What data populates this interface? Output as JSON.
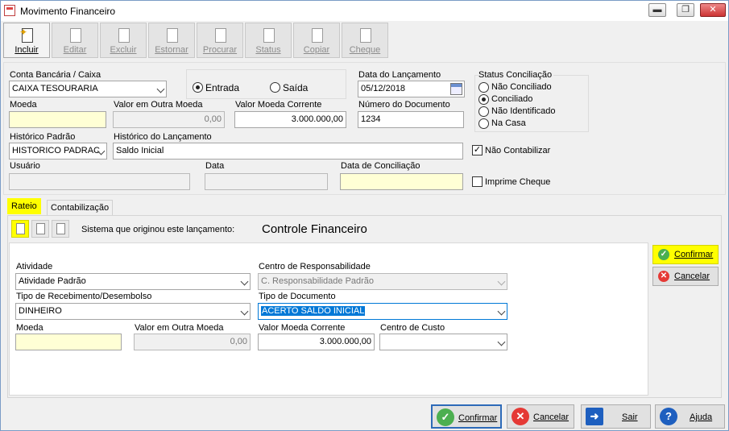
{
  "window": {
    "title": "Movimento Financeiro",
    "min": "▬",
    "max": "❐",
    "close": "✕"
  },
  "toolbar": [
    {
      "label": "Incluir",
      "icon": "new-document-icon",
      "active": true
    },
    {
      "label": "Editar",
      "icon": "edit-document-icon",
      "active": false
    },
    {
      "label": "Excluir",
      "icon": "delete-document-icon",
      "active": false
    },
    {
      "label": "Estornar",
      "icon": "reverse-icon",
      "active": false
    },
    {
      "label": "Procurar",
      "icon": "search-document-icon",
      "active": false
    },
    {
      "label": "Status",
      "icon": "status-icon",
      "active": false
    },
    {
      "label": "Copiar",
      "icon": "copy-icon",
      "active": false
    },
    {
      "label": "Cheque",
      "icon": "cheque-icon",
      "active": false
    }
  ],
  "form": {
    "conta_label": "Conta Bancária / Caixa",
    "conta_value": "CAIXA TESOURARIA",
    "entrada_label": "Entrada",
    "saida_label": "Saída",
    "tipo_selected": "Entrada",
    "data_label": "Data do Lançamento",
    "data_value": "05/12/2018",
    "status_label": "Status Conciliação",
    "status_options": [
      "Não Conciliado",
      "Conciliado",
      "Não Identificado",
      "Na Casa"
    ],
    "status_selected": "Conciliado",
    "moeda_label": "Moeda",
    "moeda_value": "",
    "valor_outra_label": "Valor em Outra Moeda",
    "valor_outra_value": "0,00",
    "valor_corrente_label": "Valor Moeda Corrente",
    "valor_corrente_value": "3.000.000,00",
    "numero_doc_label": "Número do Documento",
    "numero_doc_value": "1234",
    "historico_padrao_label": "Histórico Padrão",
    "historico_padrao_value": "HISTORICO PADRAC",
    "historico_lanc_label": "Histórico do Lançamento",
    "historico_lanc_value": "Saldo Inicial",
    "nao_contabilizar_label": "Não Contabilizar",
    "nao_contabilizar_checked": true,
    "usuario_label": "Usuário",
    "data2_label": "Data",
    "data_conciliacao_label": "Data de Conciliação",
    "imprime_cheque_label": "Imprime Cheque",
    "imprime_cheque_checked": false
  },
  "tabs": [
    {
      "label": "Rateio",
      "active": true
    },
    {
      "label": "Contabilização",
      "active": false
    }
  ],
  "rateio": {
    "sistema_label": "Sistema que originou este lançamento:",
    "sistema_value": "Controle Financeiro",
    "atividade_label": "Atividade",
    "atividade_value": "Atividade Padrão",
    "centro_resp_label": "Centro de Responsabilidade",
    "centro_resp_value": "C. Responsabilidade Padrão",
    "tipo_receb_label": "Tipo de Recebimento/Desembolso",
    "tipo_receb_value": "DINHEIRO",
    "tipo_doc_label": "Tipo de Documento",
    "tipo_doc_value": "ACERTO SALDO INICIAL",
    "moeda_label": "Moeda",
    "valor_outra_label": "Valor em Outra Moeda",
    "valor_outra_value": "0,00",
    "valor_corrente_label": "Valor Moeda Corrente",
    "valor_corrente_value": "3.000.000,00",
    "centro_custo_label": "Centro de Custo",
    "centro_custo_value": "",
    "confirmar_label": "Confirmar",
    "cancelar_label": "Cancelar"
  },
  "footer": {
    "confirmar": "Confirmar",
    "cancelar": "Cancelar",
    "sair": "Sair",
    "ajuda": "Ajuda"
  },
  "colors": {
    "highlight": "#ffff00",
    "field_yellow": "#ffffd5",
    "selection": "#0078d7"
  }
}
